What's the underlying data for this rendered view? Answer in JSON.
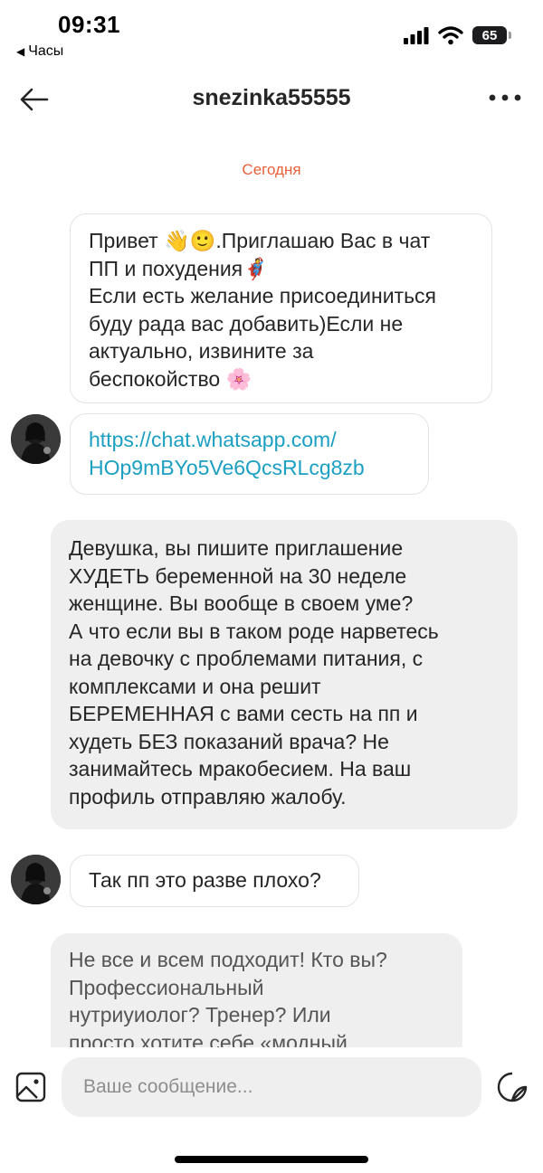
{
  "status_bar": {
    "time": "09:31",
    "back_app": "Часы",
    "battery": "65"
  },
  "header": {
    "title": "snezinka55555"
  },
  "date_separator": "Сегодня",
  "messages": [
    {
      "direction": "incoming",
      "lines": [
        "Привет 👋🙂.Приглашаю Вас в чат",
        "ПП и похудения🦸",
        "Если есть желание присоединиться",
        "буду рада вас добавить)Если не",
        "актуально, извините за",
        "беспокойство 🌸"
      ]
    },
    {
      "direction": "incoming",
      "is_link": true,
      "lines": [
        "https://chat.whatsapp.com/",
        "HOp9mBYo5Ve6QcsRLcg8zb"
      ]
    },
    {
      "direction": "outgoing",
      "lines": [
        "Девушка, вы пишите приглашение",
        "ХУДЕТЬ беременной на 30 неделе",
        "женщине. Вы вообще в своем уме?",
        "А что если вы в таком роде нарветесь",
        "на девочку с проблемами питания, с",
        "комплексами и она решит",
        "БЕРЕМЕННАЯ с вами сесть на пп и",
        "худеть БЕЗ показаний врача? Не",
        "занимайтесь мракобесием. На ваш",
        "профиль отправляю жалобу."
      ]
    },
    {
      "direction": "incoming",
      "lines": [
        "Так пп это разве плохо?"
      ]
    },
    {
      "direction": "outgoing",
      "lines": [
        "Не все и всем подходит! Кто вы?",
        "Профессиональный",
        "нутриуиолог? Тренер? Или",
        "просто хотите себе «модный"
      ]
    }
  ],
  "composer": {
    "placeholder": "Ваше сообщение..."
  },
  "icons": {
    "back": "arrow-left-icon",
    "more": "more-dots-icon",
    "gallery": "gallery-icon",
    "sticker": "sticker-icon"
  },
  "colors": {
    "accent_date": "#e6603a",
    "link": "#1b9fc2",
    "outgoing_bubble": "#efefef"
  }
}
